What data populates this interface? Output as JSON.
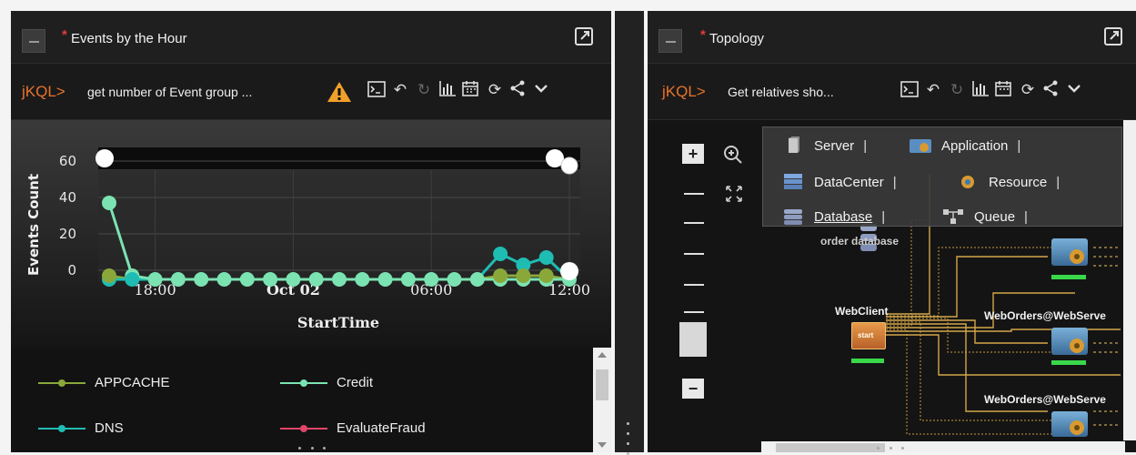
{
  "left_panel": {
    "required_mark": "*",
    "title": "Events by the Hour",
    "query_prefix": "jKQL>",
    "query_text": "get number of Event group ...",
    "warning_icon": "warning-icon",
    "chart_data": {
      "type": "line",
      "xlabel": "StartTime",
      "ylabel": "Events Count",
      "ylim": [
        0,
        60
      ],
      "y_ticks": [
        "0",
        "20",
        "40",
        "60"
      ],
      "x_ticks": [
        "18:00",
        "Oct 02",
        "06:00",
        "12:00"
      ],
      "x": [
        "16:00",
        "17:00",
        "18:00",
        "19:00",
        "20:00",
        "21:00",
        "22:00",
        "23:00",
        "00:00",
        "01:00",
        "02:00",
        "03:00",
        "04:00",
        "05:00",
        "06:00",
        "07:00",
        "08:00",
        "09:00",
        "10:00",
        "11:00",
        "12:00"
      ],
      "series": [
        {
          "name": "APPCACHE",
          "color": "#8aa83a",
          "values": [
            2,
            0,
            0,
            0,
            0,
            0,
            0,
            0,
            0,
            0,
            0,
            0,
            0,
            0,
            0,
            0,
            0,
            2,
            2,
            2,
            0
          ]
        },
        {
          "name": "Credit",
          "color": "#7be3b2",
          "values": [
            42,
            2,
            0,
            0,
            0,
            0,
            0,
            0,
            0,
            0,
            0,
            0,
            0,
            0,
            0,
            0,
            0,
            0,
            0,
            0,
            0
          ]
        },
        {
          "name": "DNS",
          "color": "#1fbcb3",
          "values": [
            0,
            0,
            0,
            0,
            0,
            0,
            0,
            0,
            0,
            0,
            0,
            0,
            0,
            0,
            0,
            0,
            0,
            14,
            8,
            12,
            0
          ]
        },
        {
          "name": "EvaluateFraud",
          "color": "#e0466a",
          "values": [
            0,
            0,
            0,
            0,
            0,
            0,
            0,
            0,
            0,
            0,
            0,
            0,
            0,
            0,
            0,
            0,
            0,
            0,
            0,
            0,
            0
          ]
        }
      ],
      "legend": [
        "APPCACHE",
        "Credit",
        "DNS",
        "EvaluateFraud"
      ]
    }
  },
  "right_panel": {
    "required_mark": "*",
    "title": "Topology",
    "query_prefix": "jKQL>",
    "query_text": "Get relatives sho...",
    "legend": {
      "server": "Server",
      "application": "Application",
      "datacenter": "DataCenter",
      "resource": "Resource",
      "database": "Database",
      "queue": "Queue",
      "separator": "|"
    },
    "nodes": {
      "database_label": "order database",
      "webclient_label": "WebClient",
      "webclient_badge": "start",
      "weborders1_label": "WebOrders@WebServe",
      "weborders2_label": "WebOrders@WebServe"
    }
  }
}
